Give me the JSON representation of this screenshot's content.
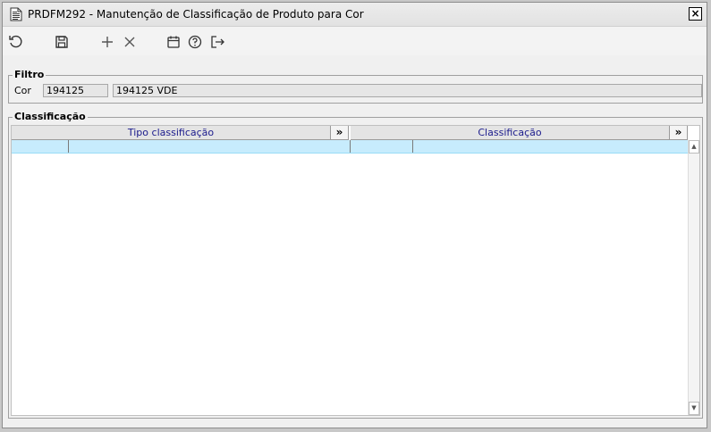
{
  "window": {
    "title": "PRDFM292 - Manutenção de Classificação de Produto para Cor",
    "close_label": "×"
  },
  "toolbar": {
    "icons": [
      "refresh-icon",
      "save-icon",
      "add-icon",
      "cancel-icon",
      "calendar-icon",
      "help-icon",
      "exit-icon"
    ]
  },
  "filter": {
    "legend": "Filtro",
    "cor_label": "Cor",
    "cor_code": "194125",
    "cor_description": "194125 VDE"
  },
  "classification": {
    "legend": "Classificação",
    "columns": [
      {
        "label": "Tipo classificação",
        "more": "»"
      },
      {
        "label": "Classificação",
        "more": "»"
      }
    ],
    "rows": [
      {
        "cells": [
          "",
          "",
          "",
          ""
        ],
        "selected": true
      }
    ]
  },
  "colors": {
    "selected_row": "#c7ecfd",
    "header_text": "#1a1a8c"
  }
}
